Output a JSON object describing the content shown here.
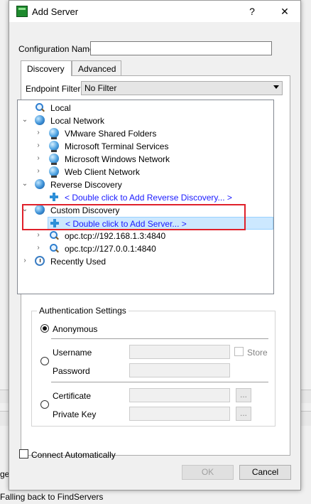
{
  "background_app": {
    "partial_text_left": "ge",
    "status_text": "Falling back to FindServers"
  },
  "dialog": {
    "title": "Add Server",
    "help_label": "?",
    "close_label": "✕",
    "config_name_label": "Configuration Name",
    "config_name_value": "",
    "tabs": [
      {
        "label": "Discovery",
        "active": true
      },
      {
        "label": "Advanced",
        "active": false
      }
    ],
    "endpoint_filter_label": "Endpoint Filter:",
    "endpoint_filter_value": "No Filter",
    "tree": [
      {
        "label": "Local",
        "icon": "search-icon",
        "expander": "",
        "level": 0
      },
      {
        "label": "Local Network",
        "icon": "globe-icon",
        "expander": "expanded",
        "level": 0
      },
      {
        "label": "VMware Shared Folders",
        "icon": "network-icon",
        "expander": "collapsed",
        "level": 1
      },
      {
        "label": "Microsoft Terminal Services",
        "icon": "network-icon",
        "expander": "collapsed",
        "level": 1
      },
      {
        "label": "Microsoft Windows Network",
        "icon": "network-icon",
        "expander": "collapsed",
        "level": 1
      },
      {
        "label": "Web Client Network",
        "icon": "network-icon",
        "expander": "collapsed",
        "level": 1
      },
      {
        "label": "Reverse Discovery",
        "icon": "globe-icon",
        "expander": "expanded",
        "level": 0
      },
      {
        "label": "< Double click to Add Reverse Discovery... >",
        "icon": "plus-icon",
        "expander": "",
        "level": 1,
        "link": true
      },
      {
        "label": "Custom Discovery",
        "icon": "globe-icon",
        "expander": "expanded",
        "level": 0
      },
      {
        "label": "< Double click to Add Server... >",
        "icon": "plus-icon",
        "expander": "",
        "level": 1,
        "link": true,
        "selected": true
      },
      {
        "label": "opc.tcp://192.168.1.3:4840",
        "icon": "search-icon",
        "expander": "collapsed",
        "level": 1
      },
      {
        "label": "opc.tcp://127.0.0.1:4840",
        "icon": "search-icon",
        "expander": "collapsed",
        "level": 1
      },
      {
        "label": "Recently Used",
        "icon": "clock-icon",
        "expander": "collapsed",
        "level": 0
      }
    ],
    "auth": {
      "title": "Authentication Settings",
      "anonymous_label": "Anonymous",
      "username_label": "Username",
      "password_label": "Password",
      "store_label": "Store",
      "certificate_label": "Certificate",
      "private_key_label": "Private Key",
      "browse_label": "...",
      "selected": "anonymous"
    },
    "connect_auto_label": "Connect Automatically",
    "ok_label": "OK",
    "cancel_label": "Cancel"
  },
  "colors": {
    "highlight_box": "#e0202a",
    "selection": "#cce8ff",
    "link": "#1a1aff"
  }
}
